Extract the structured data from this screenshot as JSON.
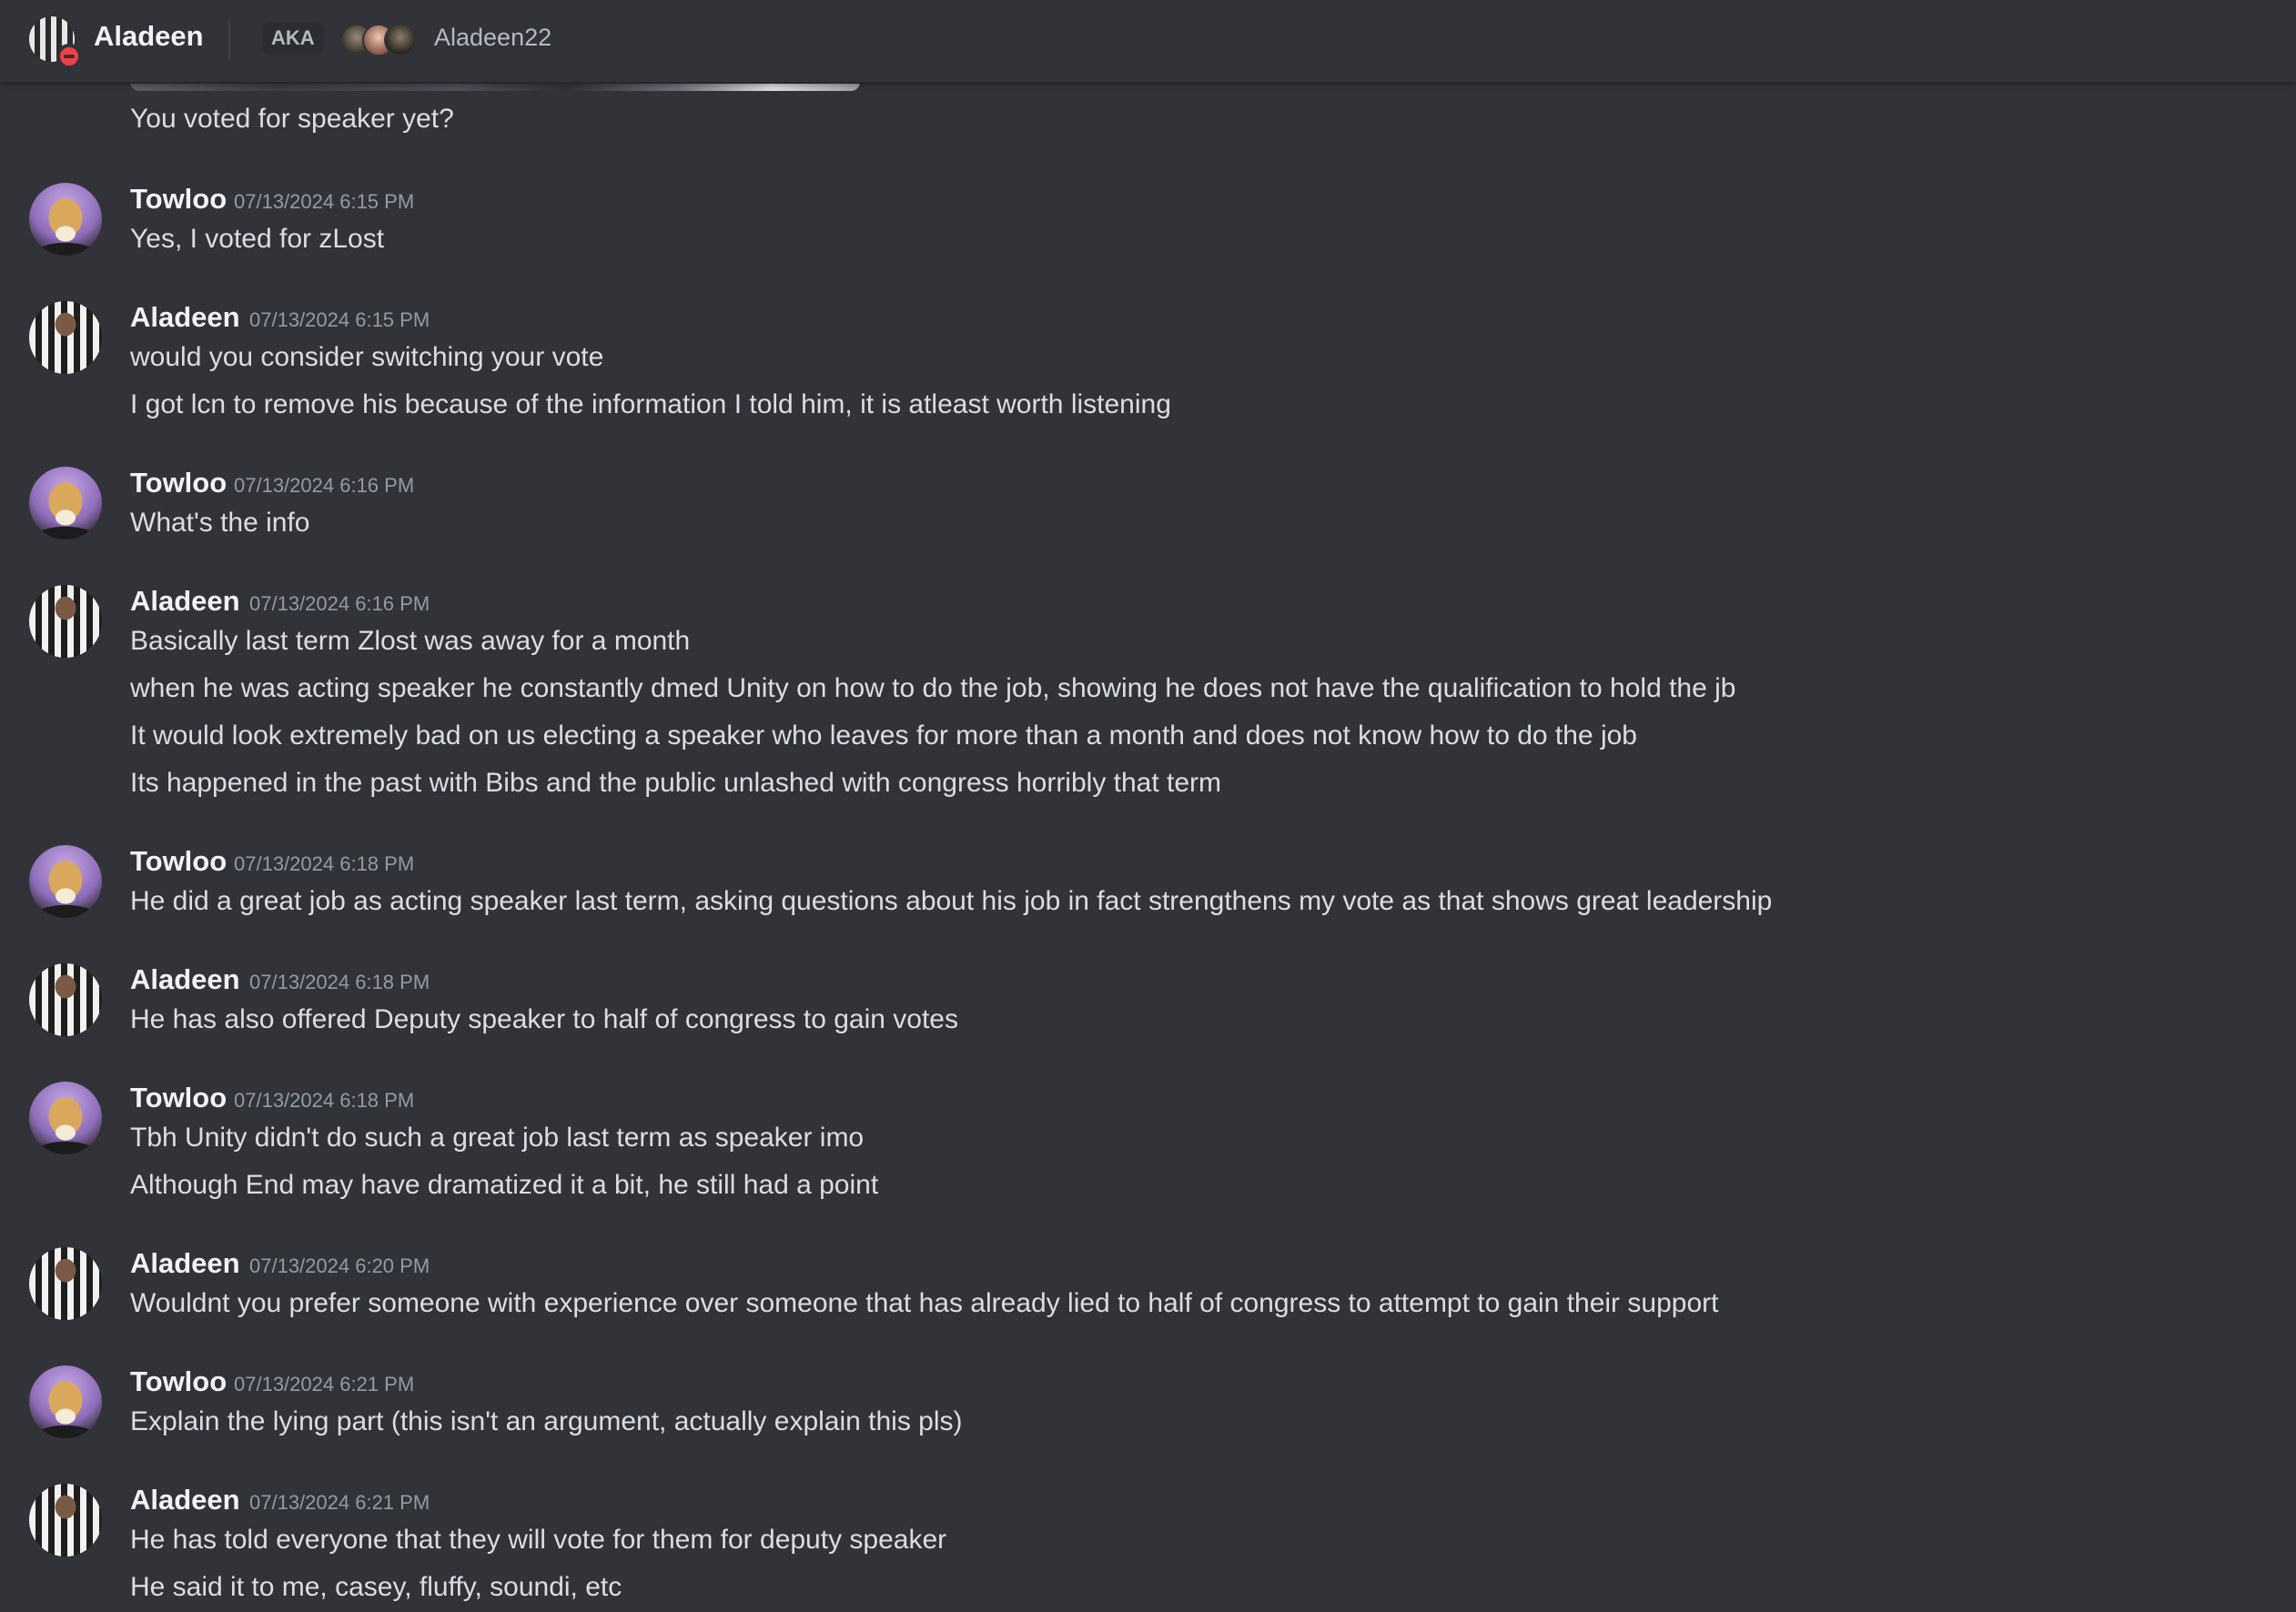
{
  "header": {
    "name": "Aladeen",
    "aka_label": "AKA",
    "alias": "Aladeen22",
    "status_color": "#f23f43"
  },
  "top_continuation": "You voted for speaker yet?",
  "messages": [
    {
      "author": "Towloo",
      "time": "07/13/2024 6:15 PM",
      "lines": [
        "Yes, I voted for zLost"
      ]
    },
    {
      "author": "Aladeen",
      "time": "07/13/2024 6:15 PM",
      "lines": [
        "would you consider switching your vote",
        "I got lcn to remove his because of the information I told him, it is atleast worth listening"
      ]
    },
    {
      "author": "Towloo",
      "time": "07/13/2024 6:16 PM",
      "lines": [
        "What's the info"
      ]
    },
    {
      "author": "Aladeen",
      "time": "07/13/2024 6:16 PM",
      "lines": [
        "Basically last term Zlost was away for a month",
        "when he was acting speaker he constantly dmed Unity on how to do the job, showing he does not have the qualification to hold the jb",
        "It would look extremely bad on us electing a speaker who leaves for more than a month and does not know how to do the job",
        "Its happened in the past with Bibs and the public unlashed with congress horribly that term"
      ]
    },
    {
      "author": "Towloo",
      "time": "07/13/2024 6:18 PM",
      "lines": [
        "He did a great job as acting speaker last term, asking questions about his job in fact strengthens my vote as that shows great leadership"
      ]
    },
    {
      "author": "Aladeen",
      "time": "07/13/2024 6:18 PM",
      "lines": [
        "He has also offered Deputy speaker to half of congress to gain votes"
      ]
    },
    {
      "author": "Towloo",
      "time": "07/13/2024 6:18 PM",
      "lines": [
        "Tbh Unity didn't do such a great job last term as speaker imo",
        "Although End may have dramatized it a bit, he still had a point"
      ]
    },
    {
      "author": "Aladeen",
      "time": "07/13/2024 6:20 PM",
      "lines": [
        "Wouldnt you prefer someone with experience over someone that has already lied to half of congress to attempt to gain their support"
      ]
    },
    {
      "author": "Towloo",
      "time": "07/13/2024 6:21 PM",
      "lines": [
        "Explain the lying part (this isn't an argument, actually explain this pls)"
      ]
    },
    {
      "author": "Aladeen",
      "time": "07/13/2024 6:21 PM",
      "lines": [
        "He has told everyone that they will vote for them for deputy speaker",
        "He said it to me, casey, fluffy, soundi, etc"
      ]
    }
  ]
}
